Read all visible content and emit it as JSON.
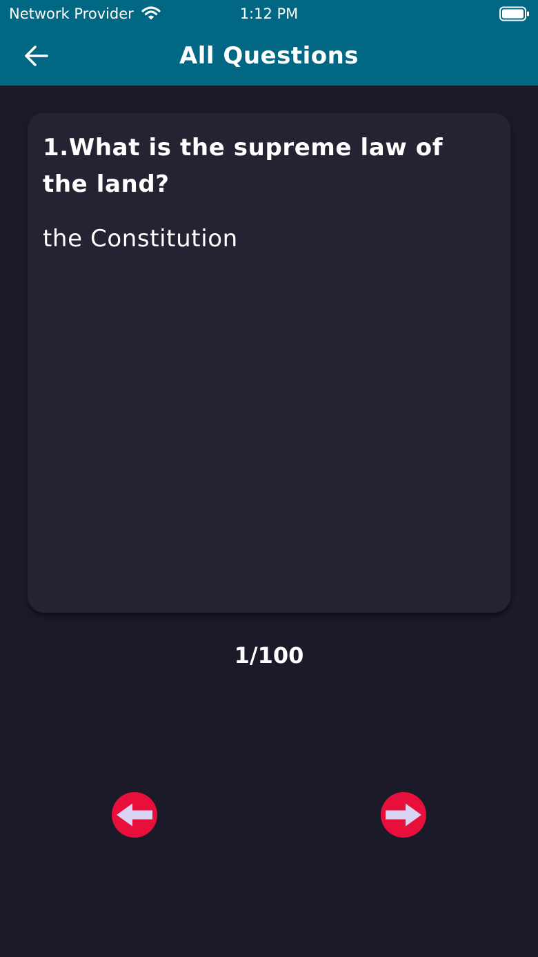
{
  "status_bar": {
    "carrier": "Network Provider",
    "time": "1:12 PM",
    "wifi_icon": "wifi-icon",
    "battery_icon": "battery-full-icon"
  },
  "nav": {
    "title": "All Questions",
    "back_icon": "arrow-left-icon"
  },
  "card": {
    "question": "1.What is the supreme law of the land?",
    "answer": "the Constitution"
  },
  "pager": {
    "counter": "1/100",
    "prev_icon": "arrow-left-circle-icon",
    "next_icon": "arrow-right-circle-icon"
  },
  "colors": {
    "header": "#016782",
    "background": "#1b1a28",
    "card": "#242332",
    "accent_button": "#e8103a",
    "arrow_fill": "#d9d4f2"
  }
}
